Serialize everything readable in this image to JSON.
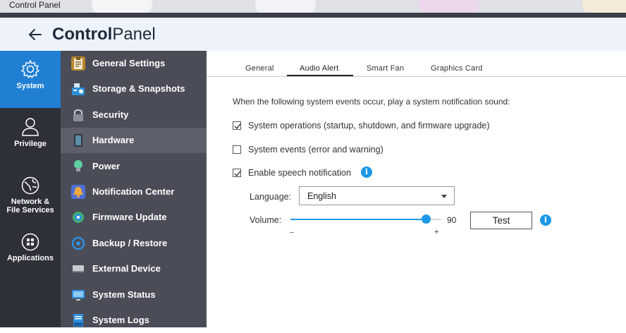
{
  "window": {
    "title": "Control Panel"
  },
  "header": {
    "title_bold": "Control",
    "title_light": "Panel"
  },
  "rail": {
    "items": [
      {
        "label": "System",
        "icon": "gear-icon",
        "active": true
      },
      {
        "label": "Privilege",
        "icon": "user-icon"
      },
      {
        "label": "Network & File Services",
        "line1": "Network &",
        "line2": "File Services",
        "icon": "globe-icon"
      },
      {
        "label": "Applications",
        "icon": "apps-grid-icon"
      }
    ]
  },
  "nav": {
    "items": [
      {
        "label": "General Settings",
        "icon": "clipboard-icon",
        "color": "#b8862e"
      },
      {
        "label": "Storage & Snapshots",
        "icon": "storage-icon",
        "color": "#2a8fd6"
      },
      {
        "label": "Security",
        "icon": "lock-icon",
        "color": "#8a8f99"
      },
      {
        "label": "Hardware",
        "icon": "hardware-icon",
        "color": "#5b8fa8",
        "active": true
      },
      {
        "label": "Power",
        "icon": "power-bulb-icon",
        "color": "#5fd0a0"
      },
      {
        "label": "Notification Center",
        "icon": "notification-icon",
        "color": "#e89a2e"
      },
      {
        "label": "Firmware Update",
        "icon": "firmware-icon",
        "color": "#3fb06a"
      },
      {
        "label": "Backup / Restore",
        "icon": "backup-icon",
        "color": "#2f8ee0"
      },
      {
        "label": "External Device",
        "icon": "external-device-icon",
        "color": "#9aa0aa"
      },
      {
        "label": "System Status",
        "icon": "monitor-icon",
        "color": "#2f8ee0"
      },
      {
        "label": "System Logs",
        "icon": "logs-icon",
        "color": "#2f8ee0"
      }
    ]
  },
  "tabs": [
    {
      "label": "General"
    },
    {
      "label": "Audio Alert",
      "active": true
    },
    {
      "label": "Smart Fan"
    },
    {
      "label": "Graphics Card"
    }
  ],
  "audio": {
    "intro": "When the following system events occur, play a system notification sound:",
    "options": [
      {
        "label": "System operations (startup, shutdown, and firmware upgrade)",
        "checked": true
      },
      {
        "label": "System events (error and warning)",
        "checked": false
      },
      {
        "label": "Enable speech notification",
        "checked": true
      }
    ],
    "language_label": "Language:",
    "language_value": "English",
    "volume_label": "Volume:",
    "volume_value": "90",
    "volume_level_percent": 90,
    "minus": "–",
    "plus": "+",
    "test_label": "Test",
    "info_glyph": "i"
  },
  "colors": {
    "accent": "#1e97e8",
    "rail_active": "#1f7fd3",
    "rail_bg": "#2d3038",
    "nav_bg": "#4a4d57"
  }
}
